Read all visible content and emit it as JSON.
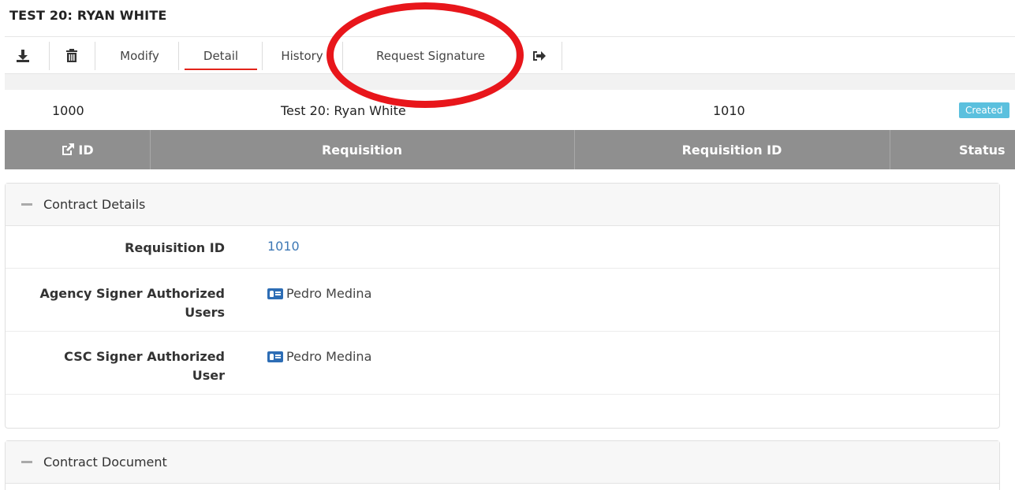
{
  "page": {
    "title": "TEST 20: RYAN WHITE"
  },
  "toolbar": {
    "download_icon": "download-icon",
    "delete_icon": "trash-icon",
    "modify": "Modify",
    "detail": "Detail",
    "history": "History",
    "request_signature": "Request Signature",
    "exit_icon": "sign-out-icon",
    "active_tab": "Detail"
  },
  "table": {
    "columns": [
      "ID",
      "Requisition",
      "Requisition ID",
      "Status"
    ],
    "row": {
      "id": "1000",
      "requisition": "Test 20: Ryan White",
      "requisition_id": "1010",
      "status": "Created"
    }
  },
  "contract_details": {
    "title": "Contract Details",
    "fields": [
      {
        "label": "Requisition ID",
        "value": "1010"
      },
      {
        "label_line1": "Agency Signer Authorized",
        "label_line2": "Users",
        "value": "Pedro Medina"
      },
      {
        "label_line1": "CSC Signer Authorized",
        "label_line2": "User",
        "value": "Pedro Medina"
      }
    ]
  },
  "contract_document": {
    "title": "Contract Document"
  },
  "colors": {
    "accent_red": "#e2231a",
    "header_gray": "#8f8f8f",
    "badge": "#5bc0de",
    "link": "#3d78b5",
    "annotation": "#e8161b"
  }
}
